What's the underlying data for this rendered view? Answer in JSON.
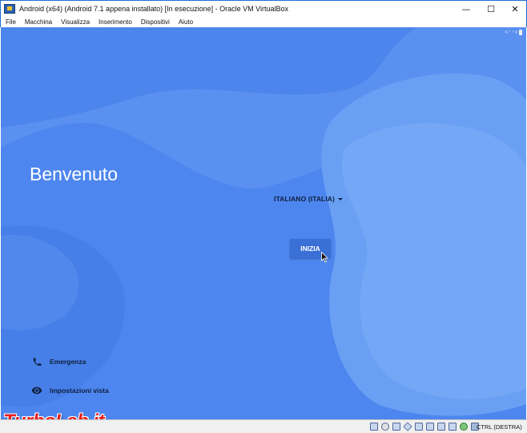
{
  "window": {
    "title": "Android (x64) (Android 7.1 appena installato) [In esecuzione] - Oracle VM VirtualBox",
    "minimize": "—",
    "maximize": "☐",
    "close": "✕"
  },
  "menu": [
    "File",
    "Macchina",
    "Visualizza",
    "Inserimento",
    "Dispositivi",
    "Aiuto"
  ],
  "android": {
    "top_indicator": "<··>",
    "welcome": "Benvenuto",
    "language": "ITALIANO (ITALIA)",
    "start_button": "INIZIA",
    "emergency": "Emergenza",
    "display_settings": "Impostazioni vista",
    "background_color": "#4d86ee"
  },
  "statusbar": {
    "icons": [
      "hard-disk-icon",
      "optical-drive-icon",
      "audio-icon",
      "network-icon",
      "usb-icon",
      "shared-folder-icon",
      "display-icon",
      "recording-icon",
      "cpu-icon",
      "mouse-integration-icon",
      "keyboard-icon"
    ],
    "host_key": "CTRL (DESTRA)"
  },
  "watermark": "TurboLab.it"
}
